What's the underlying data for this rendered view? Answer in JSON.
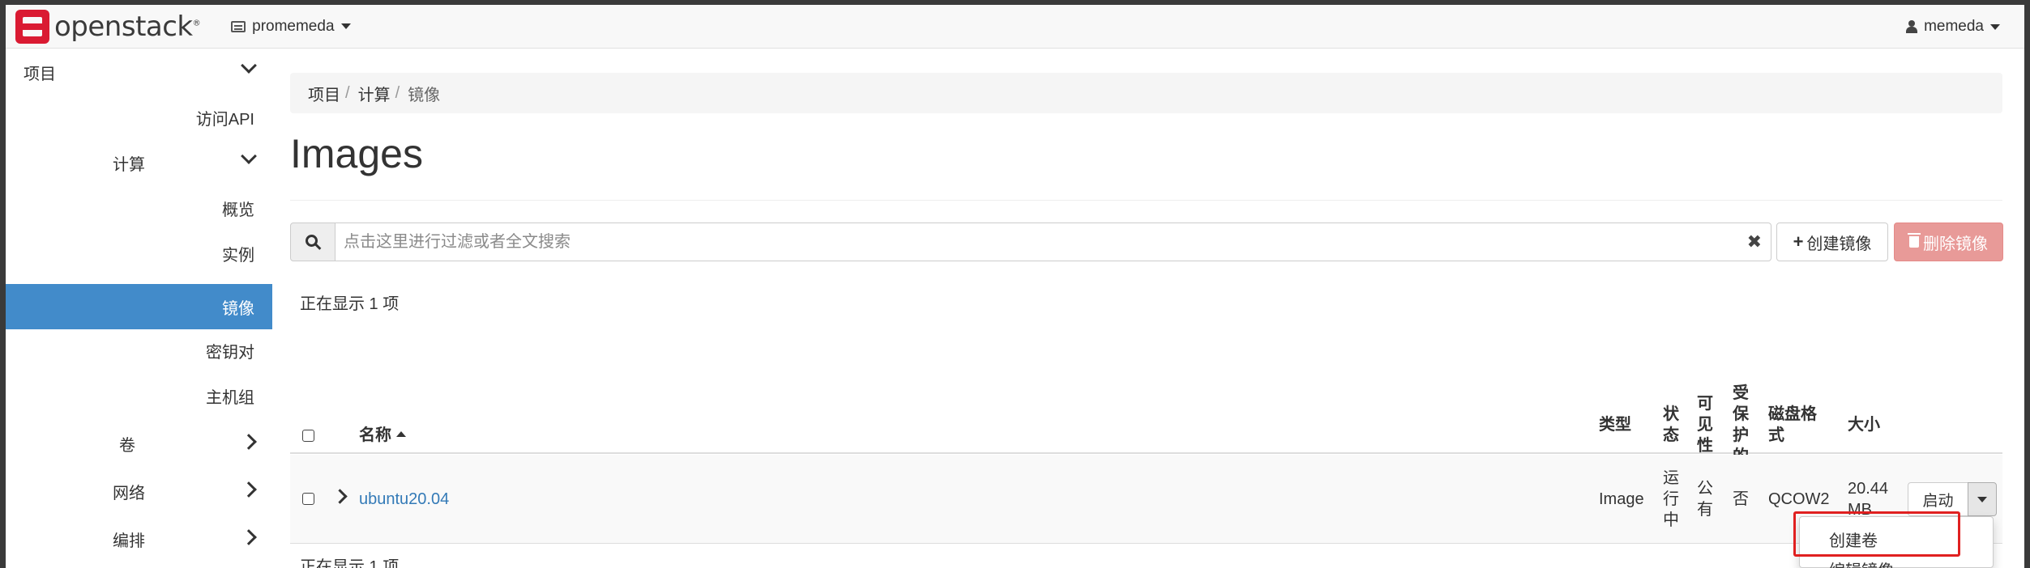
{
  "navbar": {
    "brand": "openstack",
    "brand_mark": "®",
    "project": "promemeda",
    "user": "memeda"
  },
  "sidebar": {
    "items": [
      {
        "label": "项目",
        "level": 0,
        "icon": "chevron-down-icon"
      },
      {
        "label": "访问API",
        "level": 1
      },
      {
        "label": "计算",
        "level": 1,
        "icon": "chevron-down-icon"
      },
      {
        "label": "概览",
        "level": 2
      },
      {
        "label": "实例",
        "level": 2
      },
      {
        "label": "镜像",
        "level": 2,
        "active": true
      },
      {
        "label": "密钥对",
        "level": 2
      },
      {
        "label": "主机组",
        "level": 2
      },
      {
        "label": "卷",
        "level": 1,
        "icon": "chevron-right-icon"
      },
      {
        "label": "网络",
        "level": 1,
        "icon": "chevron-right-icon"
      },
      {
        "label": "编排",
        "level": 1,
        "icon": "chevron-right-icon"
      }
    ]
  },
  "breadcrumb": {
    "items": [
      "项目",
      "计算",
      "镜像"
    ],
    "separator": "/"
  },
  "page": {
    "title": "Images"
  },
  "search": {
    "placeholder": "点击这里进行过滤或者全文搜索",
    "value": "",
    "clear_glyph": "✖"
  },
  "actions": {
    "create": "创建镜像",
    "delete": "删除镜像"
  },
  "count_text": "正在显示 1 项",
  "table": {
    "headers": {
      "name": "名称",
      "type": "类型",
      "status": "状态",
      "visibility": "可见性",
      "protected": "受保护的",
      "disk_format": "磁盘格式",
      "size": "大小"
    },
    "header_lines": {
      "status": [
        "状",
        "态"
      ],
      "visibility": [
        "可",
        "见",
        "性"
      ],
      "protected": [
        "受",
        "保",
        "护",
        "的"
      ],
      "disk_format": [
        "磁盘格",
        "式"
      ]
    },
    "rows": [
      {
        "name": "ubuntu20.04",
        "type": "Image",
        "status_lines": [
          "运",
          "行",
          "中"
        ],
        "visibility_lines": [
          "公",
          "有"
        ],
        "protected": "否",
        "disk_format": "QCOW2",
        "size_lines": [
          "20.44",
          "MB"
        ],
        "action": "启动"
      }
    ]
  },
  "dropdown": {
    "items": [
      "创建卷",
      "编辑镜像"
    ]
  },
  "colors": {
    "primary": "#428bca",
    "link": "#337ab7",
    "danger_disabled": "#e89a98",
    "brand_red": "#da1a32",
    "highlight": "#e02020"
  }
}
